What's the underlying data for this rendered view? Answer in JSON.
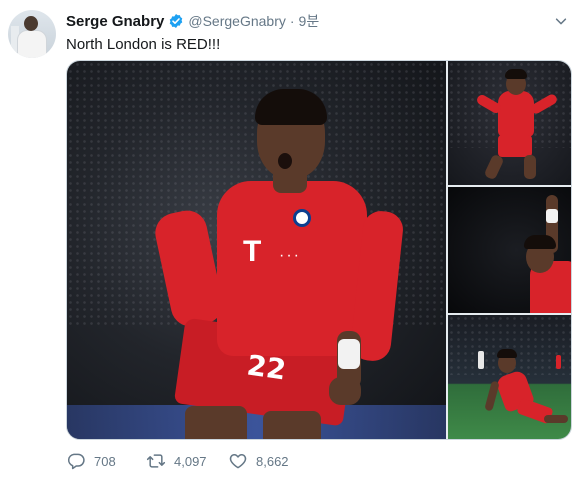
{
  "tweet": {
    "author_name": "Serge Gnabry",
    "author_handle": "@SergeGnabry",
    "separator": "·",
    "timestamp": "9분",
    "text": "North London is RED!!!",
    "verified": true,
    "media": {
      "photo_count": 4,
      "jersey_number": "22"
    },
    "actions": {
      "reply_count": "708",
      "retweet_count": "4,097",
      "like_count": "8,662"
    }
  },
  "icons": {
    "verified": "verified-badge-icon",
    "caret": "chevron-down-icon",
    "reply": "reply-icon",
    "retweet": "retweet-icon",
    "like": "heart-icon"
  },
  "colors": {
    "verified_blue": "#1da1f2",
    "secondary_text": "#657786",
    "primary_text": "#14171a",
    "kit_red": "#d8232a"
  }
}
